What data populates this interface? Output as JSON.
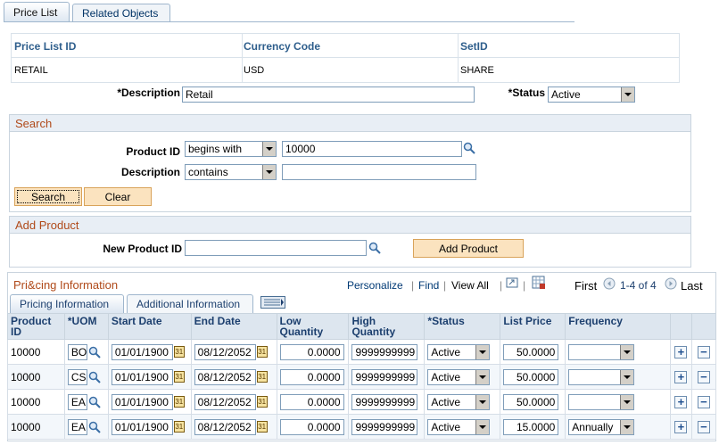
{
  "tabs": [
    {
      "label": "Price List"
    },
    {
      "label": "Related Objects"
    }
  ],
  "header": {
    "columns": [
      "Price List ID",
      "Currency Code",
      "SetID"
    ],
    "values": [
      "RETAIL",
      "USD",
      "SHARE"
    ],
    "description_label": "*Description",
    "description_value": "Retail",
    "status_label": "*Status",
    "status_value": "Active"
  },
  "search": {
    "title": "Search",
    "product_id_label": "Product ID",
    "product_id_operator": "begins with",
    "product_id_value": "10000",
    "description_label": "Description",
    "description_operator": "contains",
    "description_value": "",
    "search_button": "Search",
    "clear_button": "Clear"
  },
  "add_product": {
    "title": "Add Product",
    "new_product_label": "New Product ID",
    "new_product_value": "",
    "add_button": "Add Product"
  },
  "pricing": {
    "title": "Pri&cing Information",
    "personalize": "Personalize",
    "find": "Find",
    "view_all": "View All",
    "first": "First",
    "range": "1-4 of 4",
    "last": "Last",
    "subtabs": [
      "Pricing Information",
      "Additional Information"
    ],
    "headers": [
      "Product ID",
      "*UOM",
      "Start Date",
      "End Date",
      "Low Quantity",
      "High Quantity",
      "*Status",
      "List Price",
      "Frequency"
    ],
    "rows": [
      {
        "product_id": "10000",
        "uom": "BOX",
        "start": "01/01/1900",
        "end": "08/12/2052",
        "low": "0.0000",
        "high": "9999999999",
        "status": "Active",
        "price": "50.0000",
        "frequency": ""
      },
      {
        "product_id": "10000",
        "uom": "CS",
        "start": "01/01/1900",
        "end": "08/12/2052",
        "low": "0.0000",
        "high": "9999999999",
        "status": "Active",
        "price": "50.0000",
        "frequency": ""
      },
      {
        "product_id": "10000",
        "uom": "EA",
        "start": "01/01/1900",
        "end": "08/12/2052",
        "low": "0.0000",
        "high": "9999999999",
        "status": "Active",
        "price": "50.0000",
        "frequency": ""
      },
      {
        "product_id": "10000",
        "uom": "EA",
        "start": "01/01/1900",
        "end": "08/12/2052",
        "low": "0.0000",
        "high": "9999999999",
        "status": "Active",
        "price": "15.0000",
        "frequency": "Annually"
      }
    ],
    "calendar_glyph": "31",
    "add_row_glyph": "+",
    "delete_row_glyph": "−"
  }
}
